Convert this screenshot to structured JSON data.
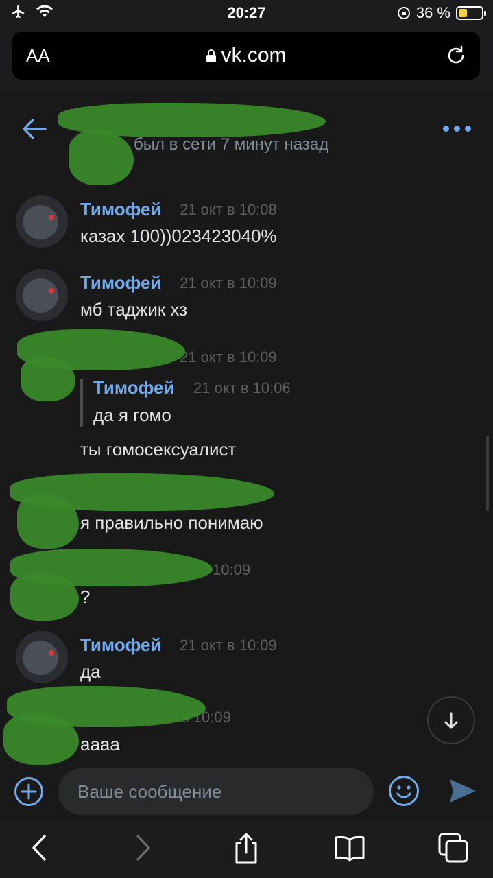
{
  "status_bar": {
    "time": "20:27",
    "battery": "36 %"
  },
  "browser": {
    "text_size_label": "AA",
    "url": "vk.com"
  },
  "chat_header": {
    "subtitle": "был в сети 7 минут назад"
  },
  "messages": [
    {
      "author": "Тимофей",
      "time": "21 окт в 10:08",
      "text": "казах 100))023423040%"
    },
    {
      "author": "Тимофей",
      "time": "21 окт в 10:09",
      "text": "мб таджик хз"
    },
    {
      "time": "21 окт в 10:09",
      "reply_author": "Тимофей",
      "reply_time": "21 окт в 10:06",
      "reply_text": "да я гомо",
      "text": "ты гомосексуалист"
    },
    {
      "text": "я правильно понимаю"
    },
    {
      "time": "10:09",
      "text": "?"
    },
    {
      "author": "Тимофей",
      "time": "21 окт в 10:09",
      "text": "да"
    },
    {
      "time": "в 10:09",
      "text": "аааа"
    }
  ],
  "composer": {
    "placeholder": "Ваше сообщение"
  },
  "icons": {
    "back": "arrow-left-icon",
    "more": "more-dots-icon",
    "add": "plus-circle-icon",
    "emoji": "smile-icon",
    "send": "send-icon",
    "scroll_down": "arrow-down-icon",
    "browser_back": "chevron-left-icon",
    "browser_forward": "chevron-right-icon",
    "share": "share-icon",
    "bookmarks": "book-icon",
    "tabs": "tabs-icon"
  },
  "colors": {
    "accent": "#71aaeb",
    "background": "#19191a",
    "scribble": "#3a8a2a"
  }
}
